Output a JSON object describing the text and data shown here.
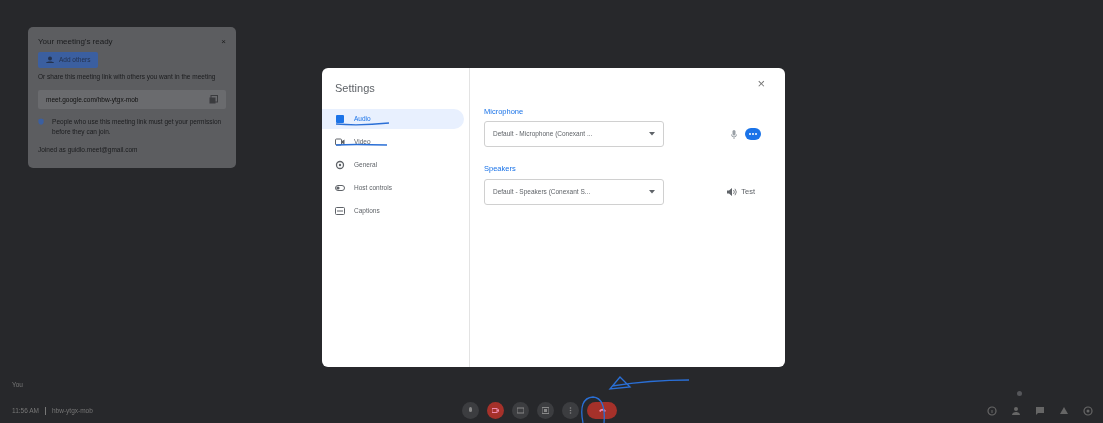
{
  "meeting_card": {
    "title": "Your meeting's ready",
    "close": "×",
    "add_button": "Add others",
    "share_text": "Or share this meeting link with others you want in the meeting",
    "link": "meet.google.com/hbw-ytgx-mob",
    "notice": "People who use this meeting link must get your permission before they can join.",
    "joined_as": "Joined as guidlo.meet@gmail.com"
  },
  "settings": {
    "title": "Settings",
    "close": "×",
    "nav": [
      {
        "label": "Audio",
        "selected": true
      },
      {
        "label": "Video",
        "selected": false
      },
      {
        "label": "General",
        "selected": false
      },
      {
        "label": "Host controls",
        "selected": false
      },
      {
        "label": "Captions",
        "selected": false
      }
    ],
    "sections": [
      {
        "kind": "microphone",
        "label": "Microphone",
        "value": "Default - Microphone (Conexant ..."
      },
      {
        "kind": "speakers",
        "label": "Speakers",
        "value": "Default - Speakers (Conexant S...",
        "action": "Test"
      }
    ]
  },
  "self_label": "You",
  "footer": {
    "time": "11:56 AM",
    "code": "hbw-ytgx-mob"
  },
  "side_icons": [
    {
      "badge": false
    },
    {
      "badge": true
    },
    {
      "badge": false
    },
    {
      "badge": false
    },
    {
      "badge": false
    }
  ]
}
